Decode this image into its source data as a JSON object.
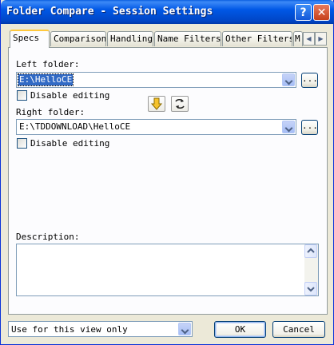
{
  "window": {
    "title": "Folder Compare - Session Settings"
  },
  "titlebar": {
    "help_label": "?",
    "close_label": "✕"
  },
  "tabs": [
    {
      "label": "Specs",
      "active": true
    },
    {
      "label": "Comparison"
    },
    {
      "label": "Handling"
    },
    {
      "label": "Name Filters"
    },
    {
      "label": "Other Filters"
    },
    {
      "label": "M"
    }
  ],
  "tab_scroll": {
    "left": "◀",
    "right": "▶"
  },
  "specs": {
    "left_folder_label": "Left folder:",
    "left_folder_value": "E:\\HelloCE",
    "left_disable_editing": "Disable editing",
    "right_folder_label": "Right folder:",
    "right_folder_value": "E:\\TDDOWNLOAD\\HelloCE",
    "right_disable_editing": "Disable editing",
    "browse_label": "...",
    "description_label": "Description:",
    "description_value": ""
  },
  "footer": {
    "scope_value": "Use for this view only",
    "ok_label": "OK",
    "cancel_label": "Cancel"
  },
  "icons": {
    "swap_down": "down-arrow-icon",
    "swap_sides": "swap-icon"
  }
}
